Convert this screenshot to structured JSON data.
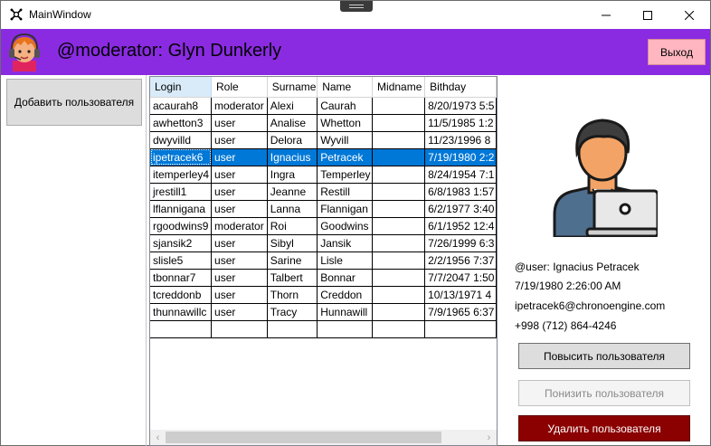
{
  "window": {
    "title": "MainWindow"
  },
  "header": {
    "title": "@moderator: Glyn Dunkerly",
    "logout_label": "Выход"
  },
  "sidebar": {
    "add_user_label": "Добавить пользователя"
  },
  "grid": {
    "columns": [
      "Login",
      "Role",
      "Surname",
      "Name",
      "Midname",
      "Bithday"
    ],
    "selected_index": 3,
    "rows": [
      [
        "acaurah8",
        "moderator",
        "Alexi",
        "Caurah",
        "",
        "8/20/1973 5:5"
      ],
      [
        "awhetton3",
        "user",
        "Analise",
        "Whetton",
        "",
        "11/5/1985 1:2"
      ],
      [
        "dwyvilld",
        "user",
        "Delora",
        "Wyvill",
        "",
        "11/23/1996 8"
      ],
      [
        "ipetracek6",
        "user",
        "Ignacius",
        "Petracek",
        "",
        "7/19/1980 2:2"
      ],
      [
        "itemperley4",
        "user",
        "Ingra",
        "Temperley",
        "",
        "8/24/1954 7:1"
      ],
      [
        "jrestill1",
        "user",
        "Jeanne",
        "Restill",
        "",
        "6/8/1983 1:57"
      ],
      [
        "lflannigana",
        "user",
        "Lanna",
        "Flannigan",
        "",
        "6/2/1977 3:40"
      ],
      [
        "rgoodwins9",
        "moderator",
        "Roi",
        "Goodwins",
        "",
        "6/1/1952 12:4"
      ],
      [
        "sjansik2",
        "user",
        "Sibyl",
        "Jansik",
        "",
        "7/26/1999 6:3"
      ],
      [
        "slisle5",
        "user",
        "Sarine",
        "Lisle",
        "",
        "2/2/1956 7:37"
      ],
      [
        "tbonnar7",
        "user",
        "Talbert",
        "Bonnar",
        "",
        "7/7/2047 1:50"
      ],
      [
        "tcreddonb",
        "user",
        "Thorn",
        "Creddon",
        "",
        "10/13/1971 4"
      ],
      [
        "thunnawillc",
        "user",
        "Tracy",
        "Hunnawill",
        "",
        "7/9/1965 6:37"
      ],
      [
        "",
        "",
        "",
        "",
        "",
        ""
      ]
    ]
  },
  "details": {
    "user": "@user: Ignacius Petracek",
    "birthday": "7/19/1980 2:26:00 AM",
    "email": "ipetracek6@chronoengine.com",
    "phone": "+998 (712) 864-4246"
  },
  "actions": {
    "promote_label": "Повысить пользователя",
    "demote_label": "Понизить пользователя",
    "delete_label": "Удалить пользователя"
  },
  "colors": {
    "header_bg": "#8a2be2",
    "logout_bg": "#ffb6c1",
    "selection": "#0078d7",
    "delete_bg": "#8b0000"
  }
}
